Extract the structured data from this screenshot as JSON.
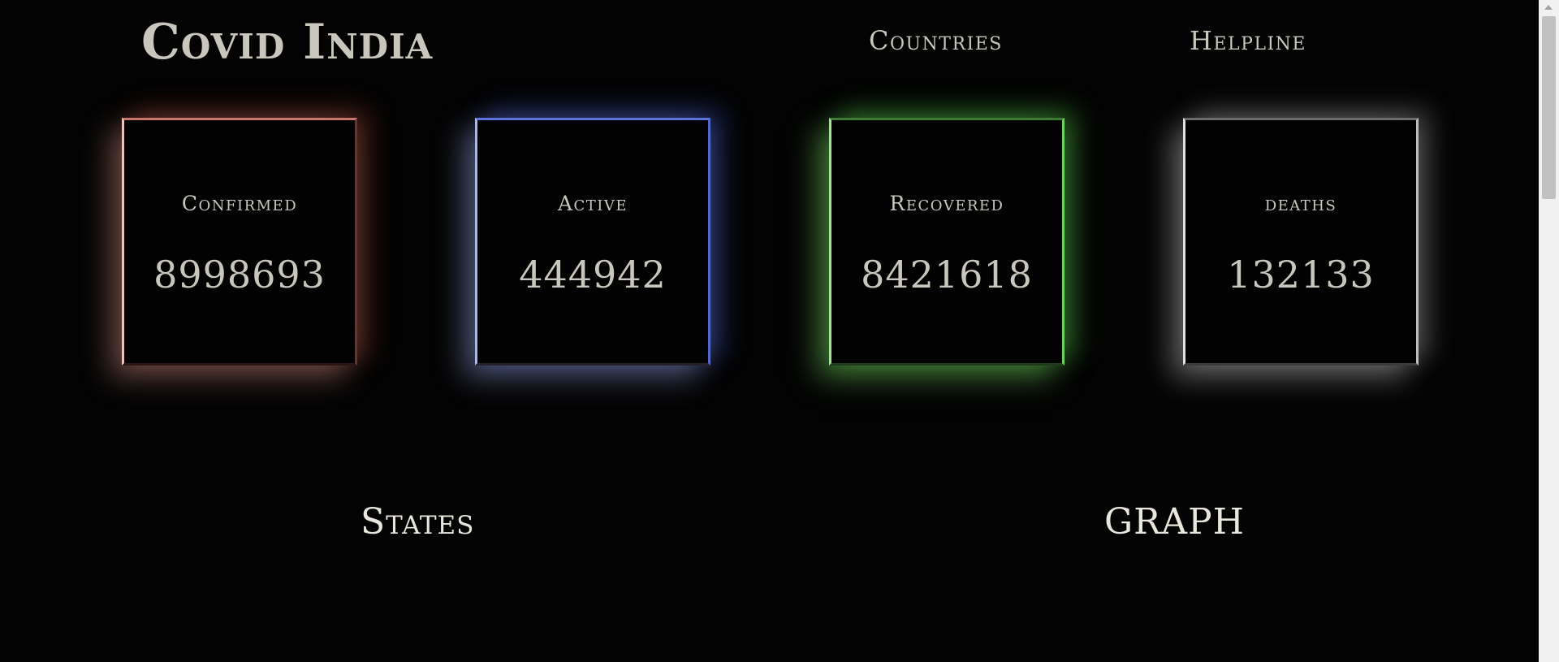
{
  "header": {
    "brand": "Covid India",
    "nav": [
      {
        "label": "Countries"
      },
      {
        "label": "Helpline"
      }
    ]
  },
  "stats": [
    {
      "label": "Confirmed",
      "value": "8998693",
      "color": "#c9766a"
    },
    {
      "label": "Active",
      "value": "444942",
      "color": "#5d72d8"
    },
    {
      "label": "Recovered",
      "value": "8421618",
      "color": "#6ad25c"
    },
    {
      "label": "deaths",
      "value": "132133",
      "color": "#bdbdbd"
    }
  ],
  "sections": {
    "states": "States",
    "graph": "GRAPH"
  },
  "colors": {
    "background": "#030303",
    "text": "#c9c7bd",
    "heading": "#e9e7dd"
  }
}
